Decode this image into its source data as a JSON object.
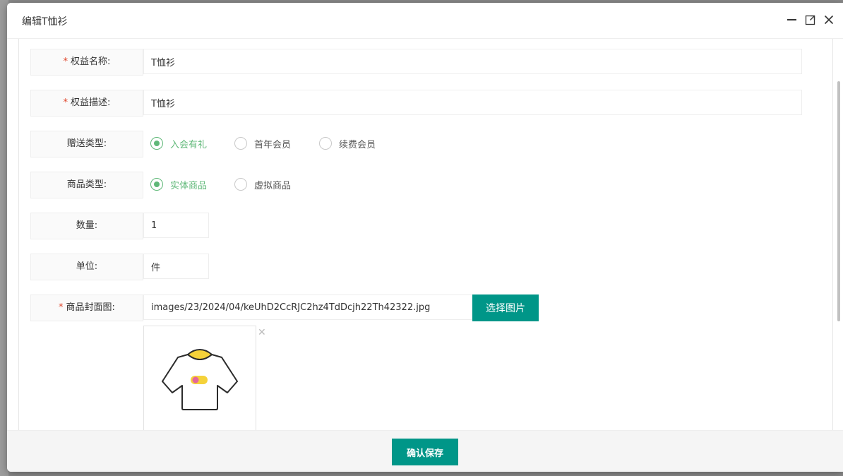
{
  "dialog": {
    "title": "编辑T恤衫",
    "icons": {
      "minimize": "minimize-icon",
      "maximize": "maximize-icon",
      "close": "close-icon"
    }
  },
  "form": {
    "name": {
      "required": "*",
      "label": "权益名称:",
      "value": "T恤衫"
    },
    "description": {
      "required": "*",
      "label": "权益描述:",
      "value": "T恤衫"
    },
    "gift_type": {
      "label": "赠送类型:",
      "options": [
        "入会有礼",
        "首年会员",
        "续费会员"
      ],
      "selected": "入会有礼"
    },
    "product_type": {
      "label": "商品类型:",
      "options": [
        "实体商品",
        "虚拟商品"
      ],
      "selected": "实体商品"
    },
    "quantity": {
      "label": "数量:",
      "value": "1"
    },
    "unit": {
      "label": "单位:",
      "value": "件"
    },
    "cover": {
      "required": "*",
      "label": "商品封面图:",
      "value": "images/23/2024/04/keUhD2CcRJC2hz4TdDcjh22Th42322.jpg",
      "button": "选择图片",
      "remove_icon": "close-icon",
      "preview_icon": "tshirt-icon"
    }
  },
  "footer": {
    "save_button": "确认保存"
  },
  "colors": {
    "primary": "#009688",
    "radio_checked": "#5fb878",
    "required": "#e0452a"
  }
}
